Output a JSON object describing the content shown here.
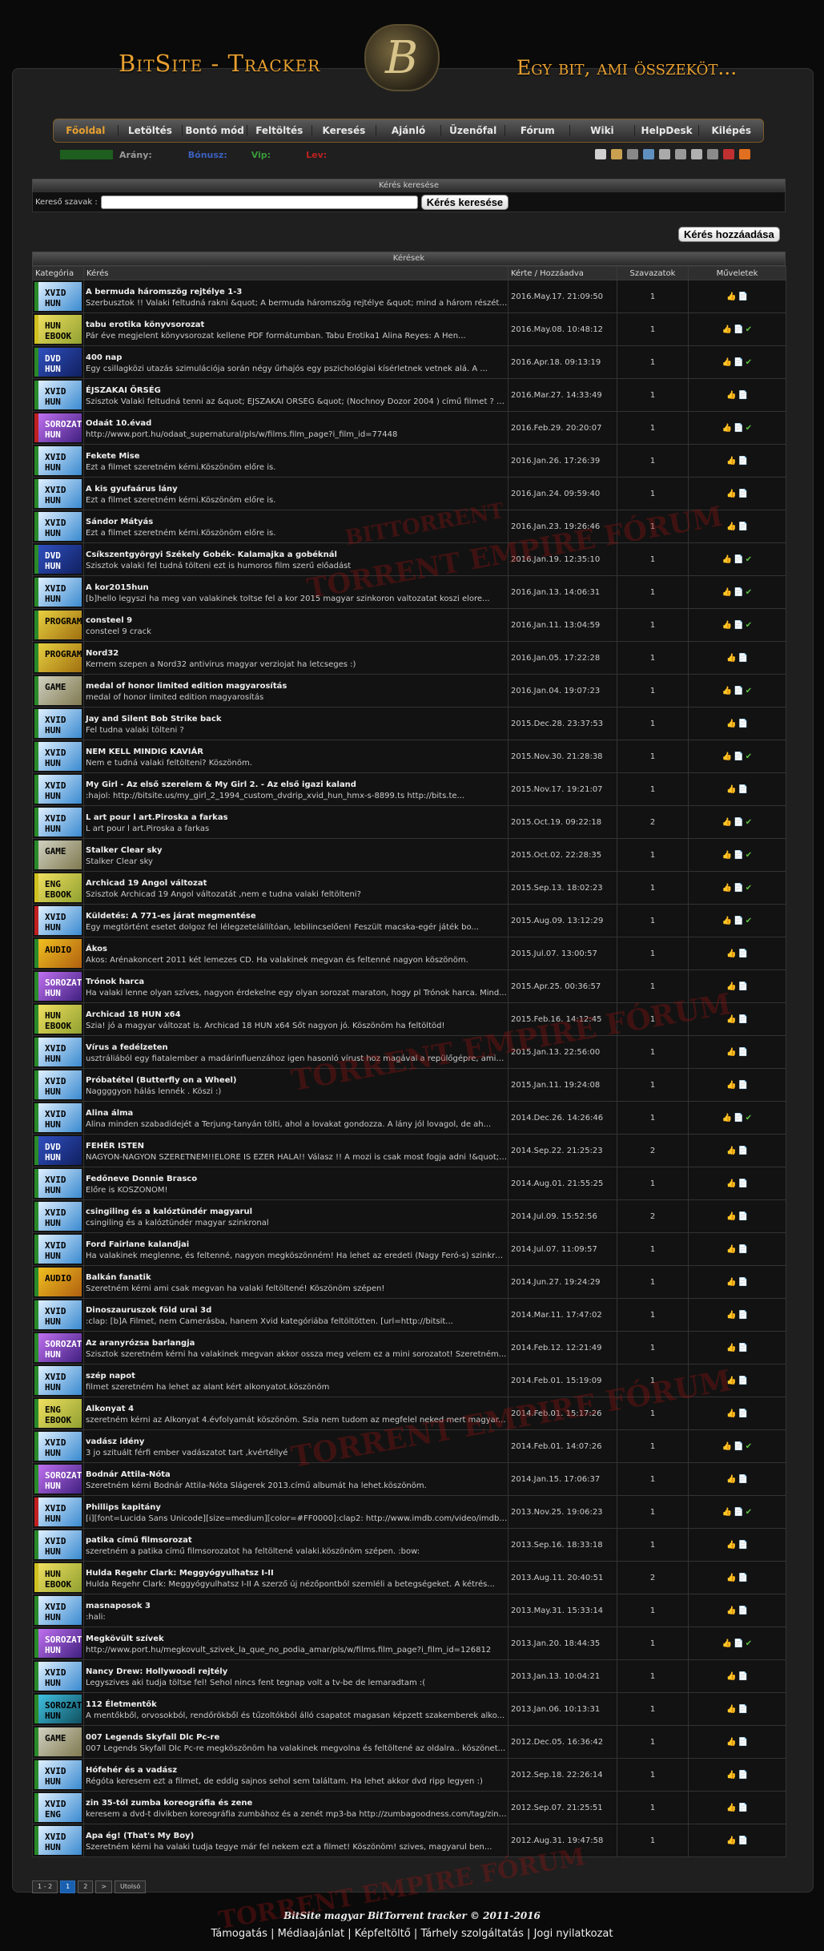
{
  "header": {
    "brand": "BitSite - Tracker",
    "slogan": "Egy bit, ami összeköt...",
    "logo_letter": "B"
  },
  "nav": [
    "Főoldal",
    "Letöltés",
    "Bontó mód",
    "Feltöltés",
    "Keresés",
    "Ajánló",
    "Üzenőfal",
    "Fórum",
    "Wiki",
    "HelpDesk",
    "Kilépés"
  ],
  "userbar": {
    "arany": "Arány:",
    "bonusz": "Bónusz:",
    "vip": "Vip:",
    "level": "Lev:"
  },
  "search": {
    "header": "Kérés keresése",
    "label": "Kereső szavak :",
    "placeholder": "",
    "button": "Kérés keresése"
  },
  "add_button": "Kérés hozzáadása",
  "requests": {
    "header": "Kérések",
    "columns": [
      "Kategória",
      "Kérés",
      "Kérte / Hozzáadva",
      "Szavazatok",
      "Műveletek"
    ],
    "rows": [
      {
        "cat": "XVID HUN",
        "cls": "x",
        "title": "A bermuda háromszög rejtélye 1-3",
        "desc": "Szerbusztok !! Valaki feltudná rakni &quot; A bermuda háromszög rejtélye &quot; mind a három részét ? ( DVDR...",
        "date": "2016.May.17. 21:09:50",
        "votes": "1",
        "ok": false
      },
      {
        "cat": "HUN EBOOK",
        "cls": "e y",
        "title": "tabu erotika könyvsorozat",
        "desc": "Pár éve megjelent könyvsorozat kellene PDF formátumban. Tabu Erotika1 Alina Reyes: A Hen...",
        "date": "2016.May.08. 10:48:12",
        "votes": "1",
        "ok": true
      },
      {
        "cat": "DVD HUN",
        "cls": "d",
        "title": "400 nap",
        "desc": "Egy csillagközi utazás szimulációja során négy űrhajós egy pszichológiai kísérletnek vetnek alá. A ...",
        "date": "2016.Apr.18. 09:13:19",
        "votes": "1",
        "ok": true
      },
      {
        "cat": "XVID HUN",
        "cls": "x",
        "title": "ÉJSZAKAI ŐRSÉG",
        "desc": "Szisztok Valaki feltudná tenni az &quot; ÉJSZAKAI ŐRSÉG &quot; (Nochnoy Dozor 2004 ) című filmet ? Előre i...",
        "date": "2016.Mar.27. 14:33:49",
        "votes": "1",
        "ok": false
      },
      {
        "cat": "SOROZAT HUN",
        "cls": "m r",
        "title": "Odaát 10.évad",
        "desc": "http://www.port.hu/odaat_supernatural/pls/w/films.film_page?i_film_id=77448",
        "date": "2016.Feb.29. 20:20:07",
        "votes": "1",
        "ok": true
      },
      {
        "cat": "XVID HUN",
        "cls": "x",
        "title": "Fekete Mise",
        "desc": "Ezt a filmet szeretném kérni.Köszönöm előre is.",
        "date": "2016.Jan.26. 17:26:39",
        "votes": "1",
        "ok": false
      },
      {
        "cat": "XVID HUN",
        "cls": "x",
        "title": "A kis gyufaárus lány",
        "desc": "Ezt a filmet szeretném kérni.Köszönöm előre is.",
        "date": "2016.Jan.24. 09:59:40",
        "votes": "1",
        "ok": false
      },
      {
        "cat": "XVID HUN",
        "cls": "x",
        "title": "Sándor Mátyás",
        "desc": "Ezt a filmet szeretném kérni.Köszönöm előre is.",
        "date": "2016.Jan.23. 19:26:46",
        "votes": "1",
        "ok": false
      },
      {
        "cat": "DVD HUN",
        "cls": "d",
        "title": "Csíkszentgyörgyi Székely Gobék- Kalamajka a gobéknál",
        "desc": "Szisztok valaki fel tudná tölteni ezt is humoros film szerű előadást",
        "date": "2016.Jan.19. 12:35:10",
        "votes": "1",
        "ok": true
      },
      {
        "cat": "XVID HUN",
        "cls": "x",
        "title": "A kor2015hun",
        "desc": "[b]hello legyszi ha meg van valakinek toltse fel a kor 2015 magyar szinkoron valtozatat koszi elore...",
        "date": "2016.Jan.13. 14:06:31",
        "votes": "1",
        "ok": true
      },
      {
        "cat": "PROGRAM",
        "cls": "p",
        "title": "consteel 9",
        "desc": "consteel 9 crack",
        "date": "2016.Jan.11. 13:04:59",
        "votes": "1",
        "ok": true
      },
      {
        "cat": "PROGRAM",
        "cls": "p",
        "title": "Nord32",
        "desc": "Kernem szepen a Nord32 antivirus magyar verziojat ha letcseges :)",
        "date": "2016.Jan.05. 17:22:28",
        "votes": "1",
        "ok": false
      },
      {
        "cat": "GAME",
        "cls": "g",
        "title": "medal of honor limited edition magyarosítás",
        "desc": "medal of honor limited edition magyarosítás",
        "date": "2016.Jan.04. 19:07:23",
        "votes": "1",
        "ok": true
      },
      {
        "cat": "XVID HUN",
        "cls": "x",
        "title": "Jay and Silent Bob Strike back",
        "desc": "Fel tudna valaki tölteni ?",
        "date": "2015.Dec.28. 23:37:53",
        "votes": "1",
        "ok": false
      },
      {
        "cat": "XVID HUN",
        "cls": "x",
        "title": "NEM KELL MINDIG KAVIÁR",
        "desc": "Nem e tudná valaki feltölteni? Köszönöm.",
        "date": "2015.Nov.30. 21:28:38",
        "votes": "1",
        "ok": true
      },
      {
        "cat": "XVID HUN",
        "cls": "x",
        "title": "My Girl - Az első szerelem & My Girl 2. - Az első igazi kaland",
        "desc": ":hajol: http://bitsite.us/my_girl_2_1994_custom_dvdrip_xvid_hun_hmx-s-8899.ts http://bits.te...",
        "date": "2015.Nov.17. 19:21:07",
        "votes": "1",
        "ok": false
      },
      {
        "cat": "XVID HUN",
        "cls": "x",
        "title": "L art pour l art.Piroska a farkas",
        "desc": "L art pour l art.Piroska a farkas",
        "date": "2015.Oct.19. 09:22:18",
        "votes": "2",
        "ok": true
      },
      {
        "cat": "GAME",
        "cls": "g",
        "title": "Stalker Clear sky",
        "desc": "Stalker Clear sky",
        "date": "2015.Oct.02. 22:28:35",
        "votes": "1",
        "ok": true
      },
      {
        "cat": "ENG EBOOK",
        "cls": "e y",
        "title": "Archicad 19 Angol változat",
        "desc": "Szisztok Archicad 19 Angol változatát ,nem e tudna valaki feltölteni?",
        "date": "2015.Sep.13. 18:02:23",
        "votes": "1",
        "ok": true
      },
      {
        "cat": "XVID HUN",
        "cls": "x r",
        "title": "Küldetés: A 771-es járat megmentése",
        "desc": "Egy megtörtént esetet dolgoz fel lélegzetelállítóan, lebilincselően! Feszült macska-egér játék bo...",
        "date": "2015.Aug.09. 13:12:29",
        "votes": "1",
        "ok": true
      },
      {
        "cat": "AUDIO",
        "cls": "a",
        "title": "Ákos",
        "desc": "Ákos: Arénakoncert 2011 két lemezes CD. Ha valakinek megvan és feltenné nagyon köszönöm.",
        "date": "2015.Jul.07. 13:00:57",
        "votes": "1",
        "ok": false
      },
      {
        "cat": "SOROZAT HUN",
        "cls": "m",
        "title": "Trónok harca",
        "desc": "Ha valaki lenne olyan szíves, nagyon érdekelne egy olyan sorozat maraton, hogy pl Trónok harca. Mind...",
        "date": "2015.Apr.25. 00:36:57",
        "votes": "1",
        "ok": false
      },
      {
        "cat": "HUN EBOOK",
        "cls": "e",
        "title": "Archicad 18 HUN x64",
        "desc": "Szia! jó a magyar változat is. Archicad 18 HUN x64 Sőt nagyon jó. Köszönöm ha feltöltöd!",
        "date": "2015.Feb.16. 14:12:45",
        "votes": "1",
        "ok": false
      },
      {
        "cat": "XVID HUN",
        "cls": "x",
        "title": "Vírus a fedélzeten",
        "desc": "usztráliából egy fiatalember a madárinfluenzához igen hasonló vírust hoz magával a repülőgépre, amiv...",
        "date": "2015.Jan.13. 22:56:00",
        "votes": "1",
        "ok": false
      },
      {
        "cat": "XVID HUN",
        "cls": "x",
        "title": "Próbatétel (Butterfly on a Wheel)",
        "desc": "Naggggyon hálás lennék . Köszi :)",
        "date": "2015.Jan.11. 19:24:08",
        "votes": "1",
        "ok": false
      },
      {
        "cat": "XVID HUN",
        "cls": "x",
        "title": "Alina álma",
        "desc": "Alina minden szabadidejét a Terjung-tanyán tölti, ahol a lovakat gondozza. A lány jól lovagol, de ah...",
        "date": "2014.Dec.26. 14:26:46",
        "votes": "1",
        "ok": true
      },
      {
        "cat": "DVD HUN",
        "cls": "d",
        "title": "FEHÉR ISTEN",
        "desc": "NAGYON-NAGYON SZERETNÉM!!ELŐRE IS EZER HÁLA!! Válasz !! A mozi is csak most fogja adni !&quot; ...",
        "date": "2014.Sep.22. 21:25:23",
        "votes": "2",
        "ok": false
      },
      {
        "cat": "XVID HUN",
        "cls": "x",
        "title": "Fedőneve Donnie Brasco",
        "desc": "Előre is KÖSZÖNÖM!",
        "date": "2014.Aug.01. 21:55:25",
        "votes": "1",
        "ok": false
      },
      {
        "cat": "XVID HUN",
        "cls": "x",
        "title": "csingiling és a kalóztündér magyarul",
        "desc": "csingiling és a kalóztündér magyar szinkronal",
        "date": "2014.Jul.09. 15:52:56",
        "votes": "2",
        "ok": false
      },
      {
        "cat": "XVID HUN",
        "cls": "x",
        "title": "Ford Fairlane kalandjai",
        "desc": "Ha valakinek meglenne, és feltenné, nagyon megköszönném! Ha lehet az eredeti (Nagy Feró-s) szinkronn...",
        "date": "2014.Jul.07. 11:09:57",
        "votes": "1",
        "ok": false
      },
      {
        "cat": "AUDIO",
        "cls": "a",
        "title": "Balkán fanatik",
        "desc": "Szeretném kérni ami csak megvan ha valaki feltöltené! Köszönöm szépen!",
        "date": "2014.Jun.27. 19:24:29",
        "votes": "1",
        "ok": false
      },
      {
        "cat": "XVID HUN",
        "cls": "x",
        "title": "Dinoszauruszok föld urai 3d",
        "desc": ":clap: [b]A Filmet, nem Camerásba, hanem Xvid kategóriába feltöltötten. [url=http://bitsit...",
        "date": "2014.Mar.11. 17:47:02",
        "votes": "1",
        "ok": false
      },
      {
        "cat": "SOROZAT HUN",
        "cls": "m",
        "title": "Az aranyrózsa barlangja",
        "desc": "Szisztok szeretném kérni ha valakinek megvan akkor ossza meg velem ez a mini sorozatot! Szeretném...",
        "date": "2014.Feb.12. 12:21:49",
        "votes": "1",
        "ok": false
      },
      {
        "cat": "XVID HUN",
        "cls": "x",
        "title": "szép napot",
        "desc": "filmet szeretném ha lehet az alant kért alkonyatot.köszönöm",
        "date": "2014.Feb.01. 15:19:09",
        "votes": "1",
        "ok": false
      },
      {
        "cat": "ENG EBOOK",
        "cls": "e",
        "title": "Alkonyat 4",
        "desc": "szeretném kérni az Alkonyat 4.évfolyamát köszönöm. Szia nem tudom az megfelel neked mert magyar...",
        "date": "2014.Feb.01. 15:17:26",
        "votes": "1",
        "ok": false
      },
      {
        "cat": "XVID HUN",
        "cls": "x",
        "title": "vadász idény",
        "desc": "3 jo szituált férfi ember vadászatot tart ,kvértéllyé",
        "date": "2014.Feb.01. 14:07:26",
        "votes": "1",
        "ok": true
      },
      {
        "cat": "SOROZAT HUN",
        "cls": "m",
        "title": "Bodnár Attila-Nóta",
        "desc": "Szeretném kérni Bodnár Attila-Nóta Slágerek 2013.című albumát ha lehet.köszönöm.",
        "date": "2014.Jan.15. 17:06:37",
        "votes": "1",
        "ok": false
      },
      {
        "cat": "XVID HUN",
        "cls": "x r",
        "title": "Phillips kapitány",
        "desc": "[i][font=Lucida Sans Unicode][size=medium][color=#FF0000]:clap2: http://www.imdb.com/video/imdb/vi6...",
        "date": "2013.Nov.25. 19:06:23",
        "votes": "1",
        "ok": true
      },
      {
        "cat": "XVID HUN",
        "cls": "x",
        "title": "patika című filmsorozat",
        "desc": "szeretném a patika című filmsorozatot ha feltöltené valaki.köszönöm szépen. :bow:",
        "date": "2013.Sep.16. 18:33:18",
        "votes": "1",
        "ok": false
      },
      {
        "cat": "HUN EBOOK",
        "cls": "e y",
        "title": "Hulda Regehr Clark: Meggyógyulhatsz I-II",
        "desc": "Hulda Regehr Clark: Meggyógyulhatsz I-II A szerző új nézőpontból szemléli a betegségeket. A kétrés...",
        "date": "2013.Aug.11. 20:40:51",
        "votes": "2",
        "ok": false
      },
      {
        "cat": "XVID HUN",
        "cls": "x",
        "title": "masnaposok 3",
        "desc": ":hali:",
        "date": "2013.May.31. 15:33:14",
        "votes": "1",
        "ok": false
      },
      {
        "cat": "SOROZAT HUN",
        "cls": "m",
        "title": "Megkövült szívek",
        "desc": "http://www.port.hu/megkovult_szivek_la_que_no_podia_amar/pls/w/films.film_page?i_film_id=126812",
        "date": "2013.Jan.20. 18:44:35",
        "votes": "1",
        "ok": true
      },
      {
        "cat": "XVID HUN",
        "cls": "x",
        "title": "Nancy Drew: Hollywoodi rejtély",
        "desc": "Legyszives aki tudja töltse fel! Sehol nincs fent tegnap volt a tv-be de lemaradtam :(",
        "date": "2013.Jan.13. 10:04:21",
        "votes": "1",
        "ok": false
      },
      {
        "cat": "SOROZAT HUN",
        "cls": "s",
        "title": "112 Életmentők",
        "desc": "A mentőkből, orvosokból, rendőrökből és tűzoltókból álló csapatot magasan képzett szakemberek alko...",
        "date": "2013.Jan.06. 10:13:31",
        "votes": "1",
        "ok": false
      },
      {
        "cat": "GAME",
        "cls": "g",
        "title": "007 Legends Skyfall Dlc Pc-re",
        "desc": "007 Legends Skyfall Dlc Pc-re megköszönöm ha valakinek megvolna és feltöltené az oldalra.. köszönet...",
        "date": "2012.Dec.05. 16:36:42",
        "votes": "1",
        "ok": false
      },
      {
        "cat": "XVID HUN",
        "cls": "x",
        "title": "Hófehér és a vadász",
        "desc": "Régóta keresem ezt a filmet, de eddig sajnos sehol sem találtam. Ha lehet akkor dvd ripp legyen :)",
        "date": "2012.Sep.18. 22:26:14",
        "votes": "1",
        "ok": false
      },
      {
        "cat": "XVID ENG",
        "cls": "x",
        "title": "zin 35-tól zumba koreográfia és zene",
        "desc": "keresem a dvd-t divikben koreográfia zumbához és a zenét mp3-ba http://zumbagoodness.com/tag/zin-...",
        "date": "2012.Sep.07. 21:25:51",
        "votes": "1",
        "ok": false
      },
      {
        "cat": "XVID HUN",
        "cls": "x",
        "title": "Apa ég! (That's My Boy)",
        "desc": "Szeretném kérni ha valaki tudja tegye már fel nekem ezt a filmet! Köszönöm! szives, magyarul ben...",
        "date": "2012.Aug.31. 19:47:58",
        "votes": "1",
        "ok": false
      }
    ]
  },
  "pager": [
    "1 - 2",
    "1",
    "2",
    ">",
    "Utolsó"
  ],
  "footer": {
    "credit": "BitSite magyar BitTorrent tracker © 2011-2016",
    "links": [
      "Támogatás",
      "Médiaajánlat",
      "Képfeltöltő",
      "Tárhely szolgáltatás",
      "Jogi nyilatkozat"
    ]
  },
  "watermark": {
    "line1": "BITTORRENT",
    "line2": "TORRENT EMPIRE FÓRUM"
  }
}
